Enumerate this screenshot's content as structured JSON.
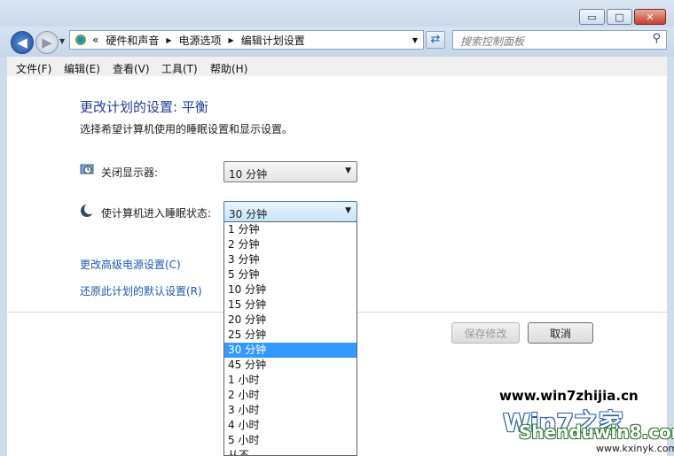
{
  "window": {
    "caption_buttons": {
      "minimize": "▭",
      "maximize": "□",
      "close": "✕"
    }
  },
  "nav": {
    "back_icon": "back-arrow-icon",
    "forward_icon": "forward-arrow-icon",
    "breadcrumb_prefix": "«",
    "breadcrumb": [
      "硬件和声音",
      "电源选项",
      "编辑计划设置"
    ],
    "breadcrumb_sep": "▶",
    "search_placeholder": "搜索控制面板"
  },
  "menu": [
    "文件(F)",
    "编辑(E)",
    "查看(V)",
    "工具(T)",
    "帮助(H)"
  ],
  "page": {
    "title": "更改计划的设置: 平衡",
    "subtitle": "选择希望计算机使用的睡眠设置和显示设置。",
    "display_off": {
      "label": "关闭显示器:",
      "value": "10 分钟"
    },
    "sleep": {
      "label": "使计算机进入睡眠状态:",
      "value": "30 分钟"
    },
    "advanced_link": "更改高级电源设置(C)",
    "restore_link": "还原此计划的默认设置(R)",
    "save_button": "保存修改",
    "cancel_button": "取消"
  },
  "dropdown": {
    "options": [
      "1 分钟",
      "2 分钟",
      "3 分钟",
      "5 分钟",
      "10 分钟",
      "15 分钟",
      "20 分钟",
      "25 分钟",
      "30 分钟",
      "45 分钟",
      "1 小时",
      "2 小时",
      "3 小时",
      "4 小时",
      "5 小时",
      "从不"
    ],
    "selected": "30 分钟"
  },
  "watermark": {
    "line1": "www.win7zhijia.cn",
    "line2": "Win7之家",
    "line3": "Shenduwin8.com",
    "line4": "www.kxinyk.com"
  },
  "colors": {
    "link": "#1c58b0",
    "title": "#1e3e9a",
    "selection": "#3399ff"
  }
}
